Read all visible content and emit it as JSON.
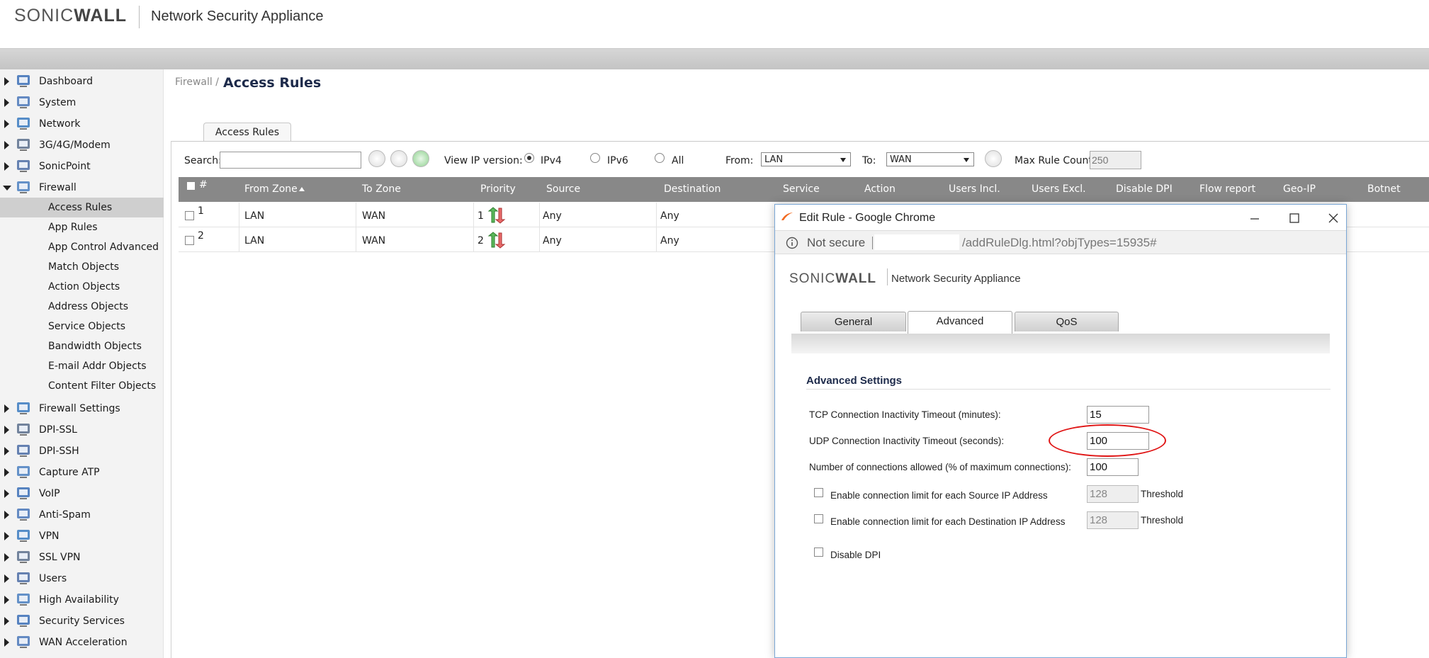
{
  "header": {
    "brand_sonic": "SONIC",
    "brand_wall": "WALL",
    "product": "Network Security Appliance"
  },
  "sidebar": {
    "items": [
      {
        "label": "Dashboard",
        "icon": "dashboard-icon"
      },
      {
        "label": "System",
        "icon": "monitor-icon"
      },
      {
        "label": "Network",
        "icon": "globe-icon"
      },
      {
        "label": "3G/4G/Modem",
        "icon": "modem-icon"
      },
      {
        "label": "SonicPoint",
        "icon": "access-point-icon"
      },
      {
        "label": "Firewall",
        "icon": "firewall-icon"
      }
    ],
    "firewall_sub": [
      "Access Rules",
      "App Rules",
      "App Control Advanced",
      "Match Objects",
      "Action Objects",
      "Address Objects",
      "Service Objects",
      "Bandwidth Objects",
      "E-mail Addr Objects",
      "Content Filter Objects"
    ],
    "items_after": [
      {
        "label": "Firewall Settings",
        "icon": "gears-icon"
      },
      {
        "label": "DPI-SSL",
        "icon": "lock-icon"
      },
      {
        "label": "DPI-SSH",
        "icon": "lock-icon"
      },
      {
        "label": "Capture ATP",
        "icon": "cloud-icon"
      },
      {
        "label": "VoIP",
        "icon": "headset-icon"
      },
      {
        "label": "Anti-Spam",
        "icon": "mail-icon"
      },
      {
        "label": "VPN",
        "icon": "vpn-icon"
      },
      {
        "label": "SSL VPN",
        "icon": "ssl-vpn-icon"
      },
      {
        "label": "Users",
        "icon": "users-icon"
      },
      {
        "label": "High Availability",
        "icon": "ha-icon"
      },
      {
        "label": "Security Services",
        "icon": "shield-icon"
      },
      {
        "label": "WAN Acceleration",
        "icon": "wan-icon"
      }
    ]
  },
  "main": {
    "breadcrumb": "Firewall /",
    "title": "Access Rules",
    "tab": "Access Rules",
    "toolbar": {
      "search_label": "Search:",
      "search_value": "",
      "view_ip_label": "View IP version:",
      "ipv4": "IPv4",
      "ipv6": "IPv6",
      "all": "All",
      "selected_ip": "IPv4",
      "from_label": "From:",
      "from_value": "LAN",
      "to_label": "To:",
      "to_value": "WAN",
      "max_rule_label": "Max Rule Count:",
      "max_rule_value": "250"
    },
    "columns": [
      "#",
      "From Zone",
      "To Zone",
      "Priority",
      "Source",
      "Destination",
      "Service",
      "Action",
      "Users Incl.",
      "Users Excl.",
      "Disable DPI",
      "Flow report",
      "Geo-IP",
      "Botnet"
    ],
    "rows": [
      {
        "num": "1",
        "from": "LAN",
        "to": "WAN",
        "priority": "1",
        "source": "Any",
        "destination": "Any"
      },
      {
        "num": "2",
        "from": "LAN",
        "to": "WAN",
        "priority": "2",
        "source": "Any",
        "destination": "Any"
      }
    ]
  },
  "popup": {
    "window_title": "Edit Rule - Google Chrome",
    "not_secure": "Not secure",
    "url_tail": "/addRuleDlg.html?objTypes=15935#",
    "brand_sonic": "SONIC",
    "brand_wall": "WALL",
    "product": "Network Security Appliance",
    "tabs": [
      "General",
      "Advanced",
      "QoS"
    ],
    "active_tab": "Advanced",
    "section_title": "Advanced Settings",
    "fields": {
      "tcp_label": "TCP Connection Inactivity Timeout (minutes):",
      "tcp_value": "15",
      "udp_label": "UDP Connection Inactivity Timeout (seconds):",
      "udp_value": "100",
      "conn_label": "Number of connections allowed (% of maximum connections):",
      "conn_value": "100",
      "src_limit_label": "Enable connection limit for each Source IP Address",
      "src_threshold": "128",
      "dst_limit_label": "Enable connection limit for each Destination IP Address",
      "dst_threshold": "128",
      "threshold_label": "Threshold",
      "disable_dpi_label": "Disable DPI"
    }
  },
  "colors": {
    "accent_orange": "#f26b21",
    "title_navy": "#1d2a4a",
    "table_header": "#888888",
    "highlight_red": "#e01515"
  }
}
